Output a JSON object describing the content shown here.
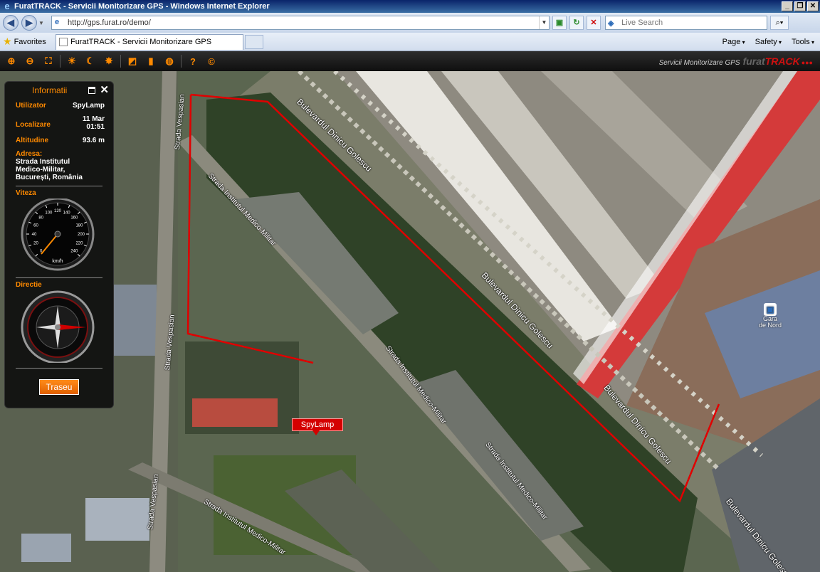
{
  "window": {
    "title": "FuratTRACK - Servicii Monitorizare GPS - Windows Internet Explorer"
  },
  "address": {
    "url": "http://gps.furat.ro/demo/"
  },
  "search": {
    "placeholder": "Live Search"
  },
  "favorites": {
    "label": "Favorites"
  },
  "tab": {
    "title": "FuratTRACK - Servicii Monitorizare GPS"
  },
  "commands": [
    "Page",
    "Safety",
    "Tools"
  ],
  "brand": {
    "subtitle": "Servicii Monitorizare GPS",
    "part1": "furat",
    "part2": "TRACK"
  },
  "panel": {
    "title": "Informatii",
    "user_label": "Utilizator",
    "user_value": "SpyLamp",
    "loc_label": "Localizare",
    "loc_date": "11 Mar",
    "loc_time": "01:51",
    "alt_label": "Altitudine",
    "alt_value": "93.6 m",
    "addr_label": "Adresa:",
    "addr_value": "Strada Institutul Medico-Militar, București, România",
    "speed_label": "Viteza",
    "speed_unit": "km/h",
    "speed_ticks": [
      "0",
      "20",
      "40",
      "60",
      "80",
      "100",
      "120",
      "140",
      "160",
      "180",
      "200",
      "220",
      "240"
    ],
    "dir_label": "Directie",
    "traseu": "Traseu"
  },
  "map": {
    "marker": "SpyLamp",
    "streets": [
      "Strada Vespasian",
      "Bulevardul Dinicu Golescu",
      "Strada Institutul Medico-Militar",
      "Bulevardul Dinicu Golescu",
      "Strada Vespasian",
      "Strada Institutul Medico-Militar",
      "Bulevardul Dinicu Golescu",
      "Strada Institutul Medico-Militar",
      "Strada Vespasian",
      "Strada Institutul Medico-Militar",
      "Bulevardul Dinicu Golescu"
    ],
    "poi_line1": "Gara",
    "poi_line2": "de Nord"
  },
  "colors": {
    "accent": "#ff8a00",
    "route": "#e00000",
    "panel_bg": "#0a0a0a"
  }
}
